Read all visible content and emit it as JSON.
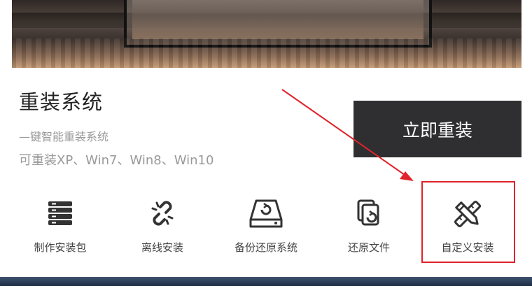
{
  "section": {
    "title": "重装系统",
    "subtitle": "—键智能重装系统",
    "systems": "可重装XP、Win7、Win8、Win10"
  },
  "primary_button": {
    "label": "立即重装"
  },
  "options": [
    {
      "label": "制作安装包",
      "icon": "stack-icon"
    },
    {
      "label": "离线安装",
      "icon": "broken-link-icon"
    },
    {
      "label": "备份还原系统",
      "icon": "disk-restore-icon"
    },
    {
      "label": "还原文件",
      "icon": "file-restore-icon"
    },
    {
      "label": "自定义安装",
      "icon": "pencil-ruler-icon"
    }
  ],
  "colors": {
    "button_bg": "#2f2f32",
    "annotation_red": "#e0232b",
    "icon": "#333333"
  }
}
